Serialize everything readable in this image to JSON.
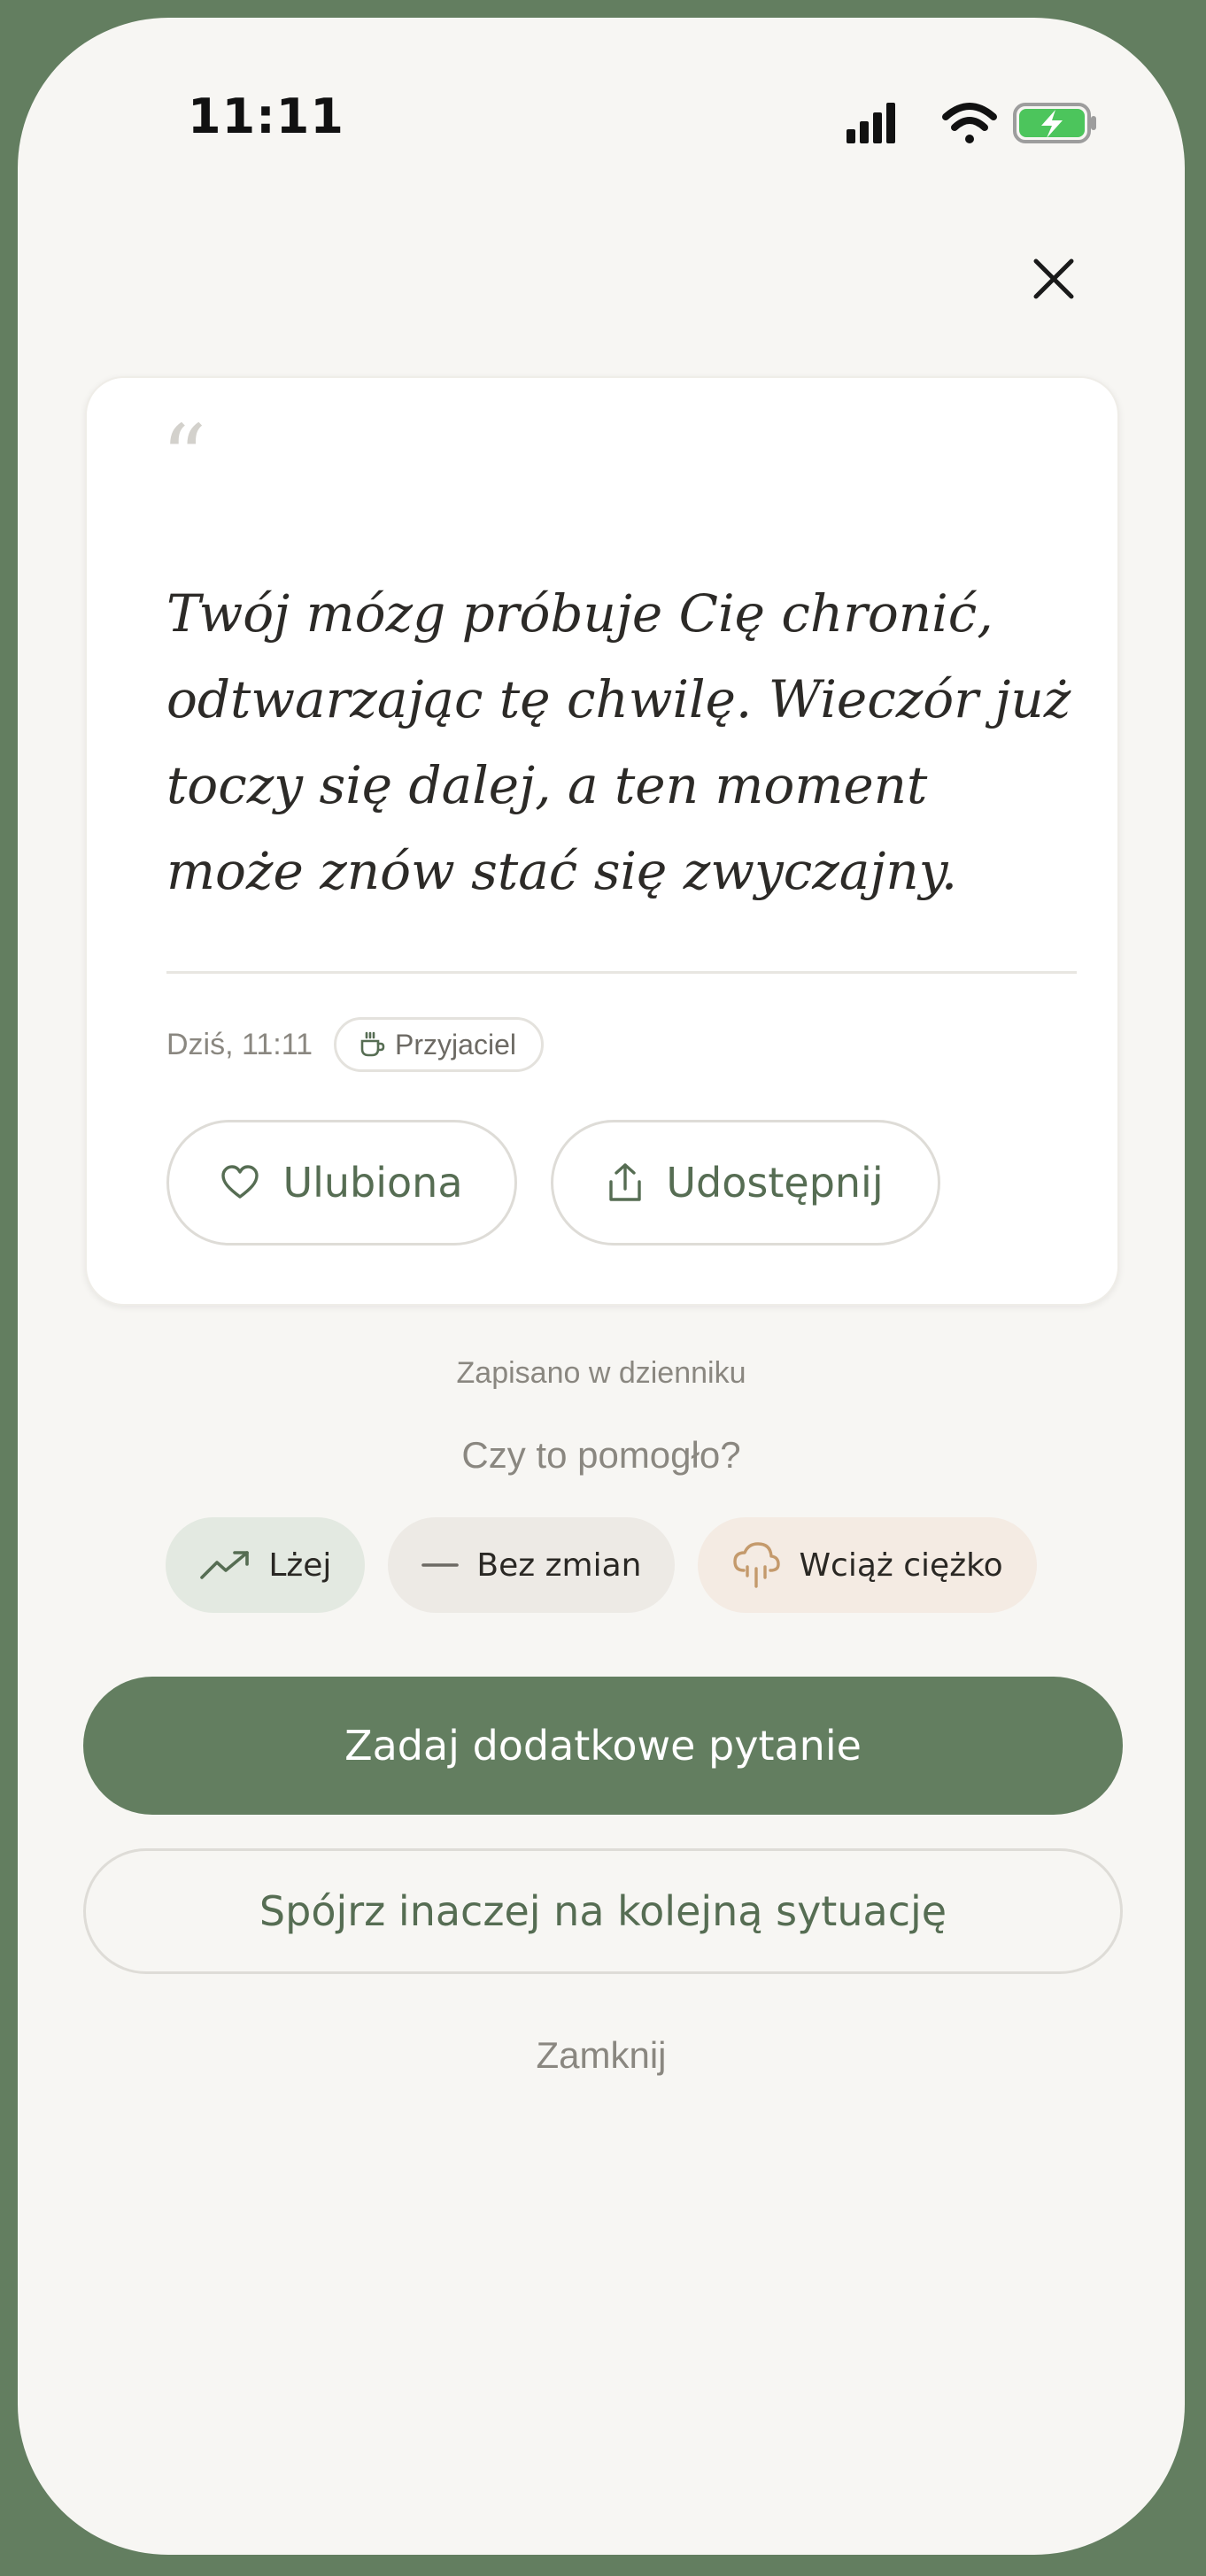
{
  "status_bar": {
    "time": "11:11",
    "icons": [
      "signal-icon",
      "wifi-icon",
      "battery-charging-icon"
    ]
  },
  "quote_card": {
    "quote_mark": "“",
    "text": "Twój mózg próbuje Cię chronić, odtwarzając tę chwilę. Wieczór już toczy się dalej, a ten moment może znów stać się zwyczajny.",
    "date": "Dziś, 11:11",
    "badge": {
      "icon": "cup-icon",
      "label": "Przyjaciel"
    },
    "actions": {
      "favorite_label": "Ulubiona",
      "share_label": "Udostępnij"
    }
  },
  "saved_note": "Zapisano w dzienniku",
  "feedback": {
    "question": "Czy to pomogło?",
    "options": [
      {
        "icon": "trend-up-icon",
        "label": "Lżej"
      },
      {
        "icon": "dash-icon",
        "label": "Bez zmian"
      },
      {
        "icon": "rain-cloud-icon",
        "label": "Wciąż ciężko"
      }
    ]
  },
  "buttons": {
    "primary": "Zadaj dodatkowe pytanie",
    "secondary": "Spójrz inaczej na kolejną sytuację",
    "close": "Zamknij"
  },
  "colors": {
    "accent": "#637e60",
    "accent_text": "#566d53",
    "background": "#f7f6f3",
    "muted_text": "#8a8780",
    "chip_lighter": "#e3e9e1",
    "chip_same": "#edeae5",
    "chip_heavy": "#f4ebe3",
    "heavy_icon": "#c49a6c",
    "battery": "#4cc55c"
  }
}
